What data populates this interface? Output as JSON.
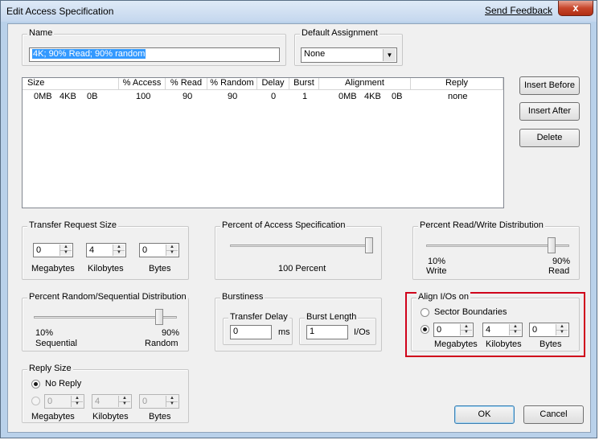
{
  "window": {
    "title": "Edit Access Specification",
    "feedback_link": "Send Feedback",
    "close_glyph": "x"
  },
  "name_group": {
    "label": "Name",
    "value": "4K; 90% Read; 90% random"
  },
  "default_assignment": {
    "label": "Default Assignment",
    "value": "None"
  },
  "list": {
    "columns": [
      "Size",
      "% Access",
      "% Read",
      "% Random",
      "Delay",
      "Burst",
      "Alignment",
      "Reply"
    ],
    "row": {
      "size_mb": "0MB",
      "size_kb": "4KB",
      "size_b": "0B",
      "access": "100",
      "read": "90",
      "random": "90",
      "delay": "0",
      "burst": "1",
      "align_mb": "0MB",
      "align_kb": "4KB",
      "align_b": "0B",
      "reply": "none"
    }
  },
  "buttons": {
    "insert_before": "Insert Before",
    "insert_after": "Insert After",
    "delete": "Delete",
    "ok": "OK",
    "cancel": "Cancel"
  },
  "transfer_size": {
    "label": "Transfer Request Size",
    "mb": "0",
    "kb": "4",
    "b": "0",
    "mb_label": "Megabytes",
    "kb_label": "Kilobytes",
    "b_label": "Bytes"
  },
  "percent_access": {
    "label": "Percent of Access Specification",
    "value_text": "100 Percent",
    "level_percent": 100
  },
  "read_write": {
    "label": "Percent Read/Write Distribution",
    "left_pct": "10%",
    "left_label": "Write",
    "right_pct": "90%",
    "right_label": "Read",
    "level_percent": 90
  },
  "random_seq": {
    "label": "Percent Random/Sequential Distribution",
    "left_pct": "10%",
    "left_label": "Sequential",
    "right_pct": "90%",
    "right_label": "Random",
    "level_percent": 90
  },
  "burstiness": {
    "label": "Burstiness",
    "delay_label": "Transfer Delay",
    "delay_value": "0",
    "delay_unit": "ms",
    "burst_label": "Burst Length",
    "burst_value": "1",
    "burst_unit": "I/Os"
  },
  "align": {
    "label": "Align I/Os on",
    "sector_label": "Sector Boundaries",
    "mb": "0",
    "kb": "4",
    "b": "0",
    "mb_label": "Megabytes",
    "kb_label": "Kilobytes",
    "b_label": "Bytes"
  },
  "reply_size": {
    "label": "Reply Size",
    "no_reply_label": "No Reply",
    "mb": "0",
    "kb": "4",
    "b": "0",
    "mb_label": "Megabytes",
    "kb_label": "Kilobytes",
    "b_label": "Bytes"
  },
  "colors": {
    "highlight": "#d0021b",
    "selection": "#3399ff"
  }
}
